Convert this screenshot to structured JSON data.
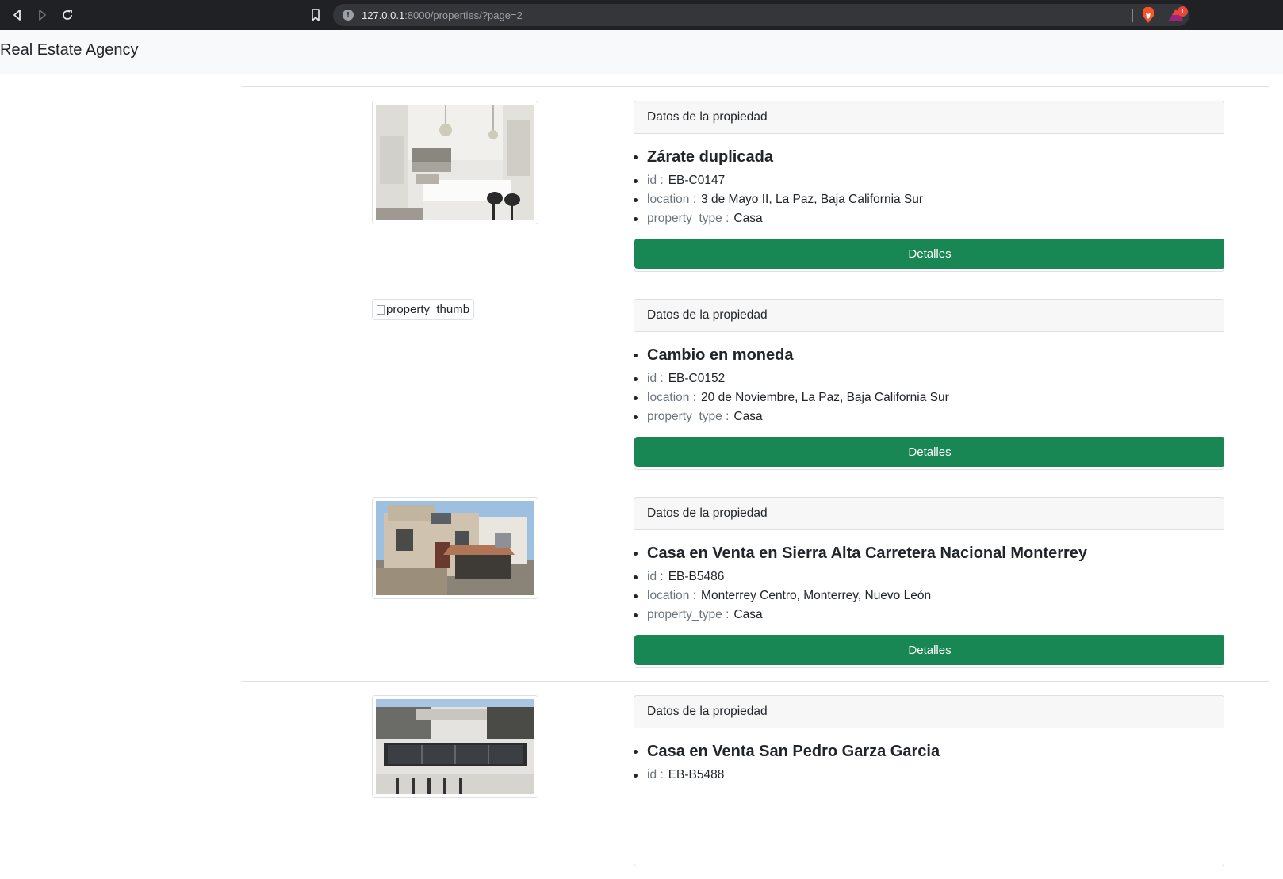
{
  "browser": {
    "url_host": "127.0.0.1",
    "url_rest": ":8000/properties/?page=2",
    "rewards_badge": "1"
  },
  "navbar": {
    "brand": "Real Estate Agency"
  },
  "properties": [
    {
      "header": "Datos de la propiedad",
      "title": "Zárate duplicada",
      "id_label": "id :",
      "id": "EB-C0147",
      "location_label": "location :",
      "location": "3 de Mayo II, La Paz, Baja California Sur",
      "type_label": "property_type :",
      "property_type": "Casa",
      "button": "Detalles",
      "image": "kitchen-photo"
    },
    {
      "header": "Datos de la propiedad",
      "title": "Cambio en moneda",
      "id_label": "id :",
      "id": "EB-C0152",
      "location_label": "location :",
      "location": "20 de Noviembre, La Paz, Baja California Sur",
      "type_label": "property_type :",
      "property_type": "Casa",
      "button": "Detalles",
      "image_alt": "property_thumb"
    },
    {
      "header": "Datos de la propiedad",
      "title": "Casa en Venta en Sierra Alta Carretera Nacional Monterrey",
      "id_label": "id :",
      "id": "EB-B5486",
      "location_label": "location :",
      "location": "Monterrey Centro, Monterrey, Nuevo León",
      "type_label": "property_type :",
      "property_type": "Casa",
      "button": "Detalles",
      "image": "house-facade-photo"
    },
    {
      "header": "Datos de la propiedad",
      "title": "Casa en Venta San Pedro Garza Garcia",
      "id_label": "id :",
      "id": "EB-B5488",
      "image": "modern-house-photo"
    }
  ]
}
